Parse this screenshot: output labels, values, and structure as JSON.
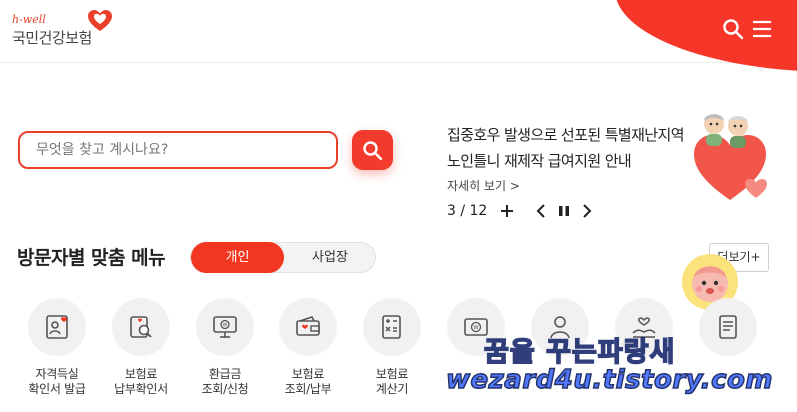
{
  "header": {
    "logo_small": "h-well",
    "logo_main": "국민건강보험",
    "search_icon": "search-icon",
    "menu_icon": "hamburger-menu-icon",
    "accent_color": "#f7362a"
  },
  "search": {
    "placeholder": "무엇을 찾고 계시나요?",
    "button_icon": "search-icon"
  },
  "notice": {
    "line1": "집중호우 발생으로 선포된 특별재난지역",
    "line2": "노인틀니 재제작 급여지원 안내",
    "more": "자세히 보기 >",
    "page": "3 / 12",
    "controls": [
      "plus-icon",
      "prev-icon",
      "pause-icon",
      "next-icon"
    ],
    "illustration": "elderly-couple-heart-illustration"
  },
  "menu": {
    "title": "방문자별 맞춤 메뉴",
    "tabs": [
      "개인",
      "사업장"
    ],
    "active_tab": "개인",
    "more_button": "더보기+",
    "chatbot_icon": "chatbot-mascot-icon",
    "items": [
      {
        "label_line1": "자격득실",
        "label_line2": "확인서 발급",
        "icon": "id-card-heart-icon"
      },
      {
        "label_line1": "보험료",
        "label_line2": "납부확인서",
        "icon": "document-search-icon"
      },
      {
        "label_line1": "환급금",
        "label_line2": "조회/신청",
        "icon": "monitor-won-icon"
      },
      {
        "label_line1": "보험료",
        "label_line2": "조회/납부",
        "icon": "wallet-icon"
      },
      {
        "label_line1": "보험료",
        "label_line2": "계산기",
        "icon": "calculator-icon"
      },
      {
        "label_line1": "",
        "label_line2": "",
        "icon": "card-won-icon"
      },
      {
        "label_line1": "",
        "label_line2": "",
        "icon": "person-icon"
      },
      {
        "label_line1": "",
        "label_line2": "",
        "icon": "heart-hands-icon"
      },
      {
        "label_line1": "",
        "label_line2": "",
        "icon": "document-icon"
      }
    ]
  },
  "watermark": {
    "line1": "꿈을 꾸는파랑새",
    "line2": "wezard4u.tistory.com"
  }
}
